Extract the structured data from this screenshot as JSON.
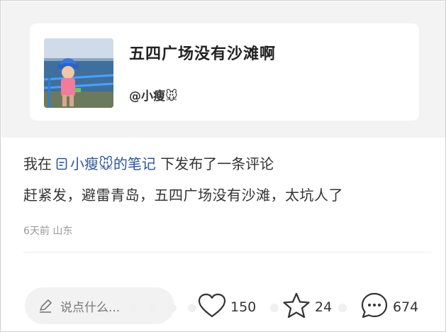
{
  "note": {
    "title": "五四广场没有沙滩啊",
    "author": "@小瘦🐭"
  },
  "comment": {
    "prefix": "我在",
    "link_text": "小瘦🐭的笔记",
    "suffix": "下发布了一条评论",
    "body": "赶紧发，避雷青岛，五四广场没有沙滩，太坑人了",
    "meta": "6天前 山东"
  },
  "actions": {
    "input_placeholder": "说点什么...",
    "likes": "150",
    "favorites": "24",
    "comments": "674"
  },
  "icons": [
    "pencil-icon",
    "document-icon",
    "heart-icon",
    "star-icon",
    "comment-bubble-icon"
  ],
  "colors": {
    "link": "#2d5596",
    "quote_background": "#f3f3f3",
    "meta_text": "#999999"
  }
}
